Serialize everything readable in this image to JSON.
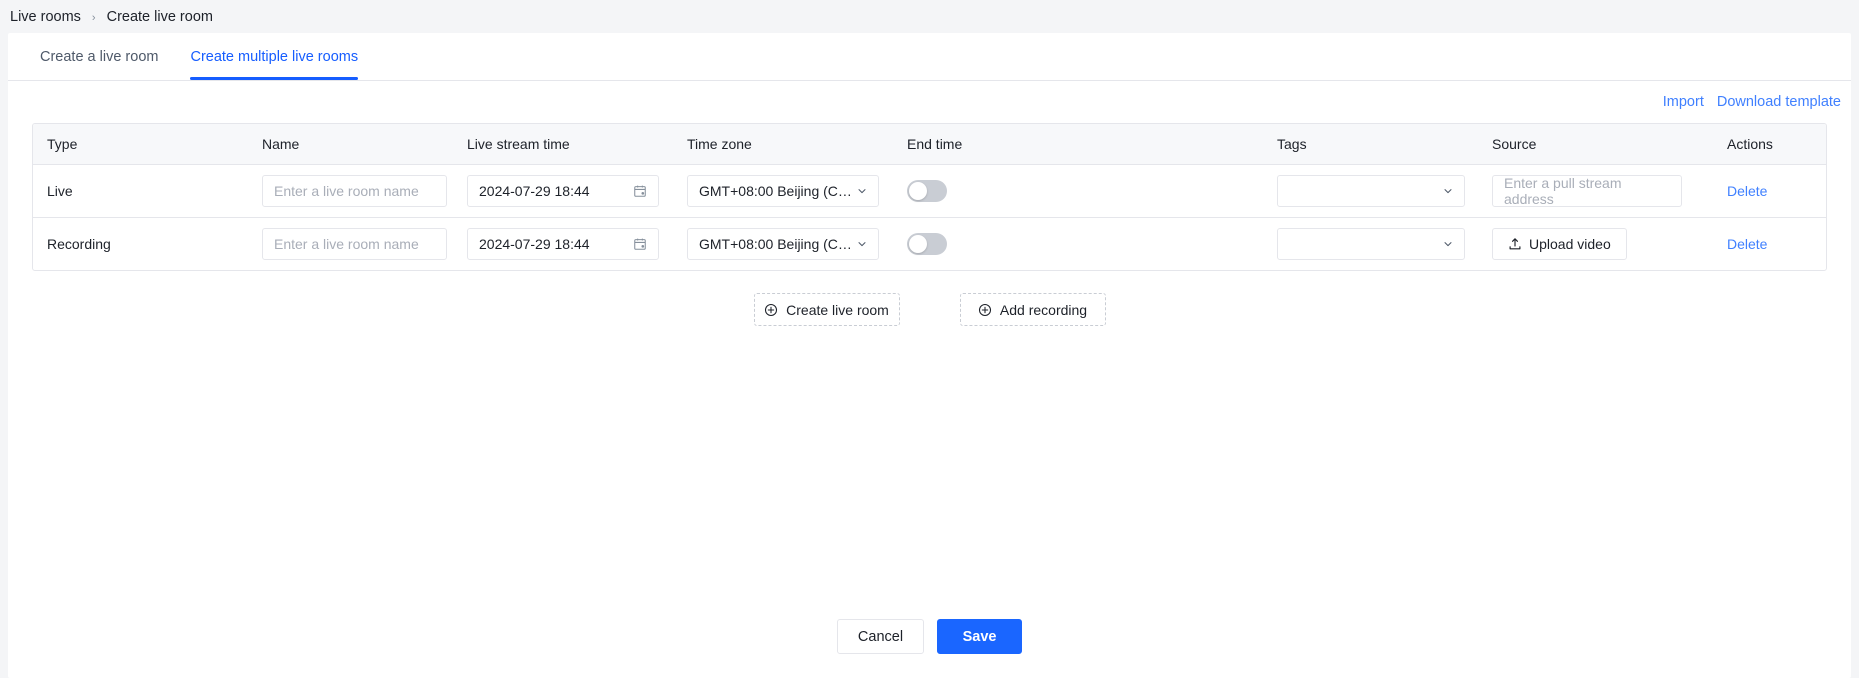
{
  "breadcrumb": {
    "items": [
      "Live rooms",
      "Create live room"
    ],
    "separator": "›"
  },
  "tabs": [
    {
      "label": "Create a live room",
      "active": false
    },
    {
      "label": "Create multiple live rooms",
      "active": true
    }
  ],
  "toolbar": {
    "import_label": "Import",
    "download_template_label": "Download template"
  },
  "table": {
    "headers": [
      "Type",
      "Name",
      "Live stream time",
      "Time zone",
      "End time",
      "Tags",
      "Source",
      "Actions"
    ],
    "rows": [
      {
        "type": "Live",
        "name_placeholder": "Enter a live room name",
        "name_value": "",
        "stream_time": "2024-07-29 18:44",
        "time_zone": "GMT+08:00 Beijing (Chi...",
        "end_time_enabled": false,
        "tags_value": "",
        "source_kind": "input",
        "source_placeholder": "Enter a pull stream address",
        "source_value": "",
        "action_label": "Delete"
      },
      {
        "type": "Recording",
        "name_placeholder": "Enter a live room name",
        "name_value": "",
        "stream_time": "2024-07-29 18:44",
        "time_zone": "GMT+08:00 Beijing (Chi...",
        "end_time_enabled": false,
        "tags_value": "",
        "source_kind": "upload",
        "source_button_label": "Upload video",
        "action_label": "Delete"
      }
    ]
  },
  "add_buttons": [
    {
      "label": "Create live room",
      "icon": "plus-circle-icon"
    },
    {
      "label": "Add recording",
      "icon": "plus-circle-icon"
    }
  ],
  "footer": {
    "cancel_label": "Cancel",
    "save_label": "Save"
  },
  "colors": {
    "accent": "#165dff",
    "link": "#4080ff",
    "primary_button": "#1a66ff",
    "page_background": "#f4f5f7",
    "panel_background": "#ffffff",
    "border": "#e5e6eb",
    "header_background": "#f7f8fa",
    "text": "#1d2129",
    "placeholder": "#a9aeb8",
    "switch_off": "#c9cdd4"
  }
}
